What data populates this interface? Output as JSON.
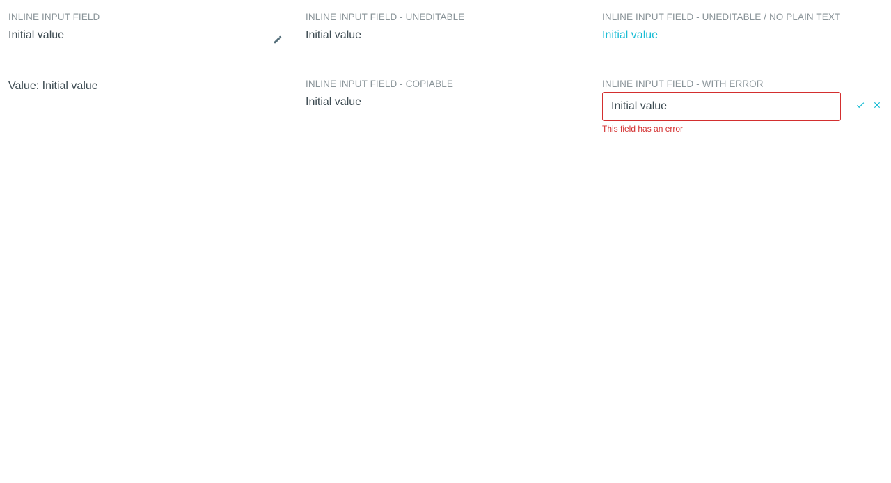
{
  "fields": {
    "inline": {
      "label": "INLINE INPUT FIELD",
      "value": "Initial value"
    },
    "uneditable": {
      "label": "INLINE INPUT FIELD - UNEDITABLE",
      "value": "Initial value"
    },
    "uneditable_no_plain": {
      "label": "INLINE INPUT FIELD - UNEDITABLE / NO PLAIN TEXT",
      "value": "Initial value"
    },
    "value_display": {
      "text": "Value: Initial value"
    },
    "copiable": {
      "label": "INLINE INPUT FIELD - COPIABLE",
      "value": "Initial value"
    },
    "with_error": {
      "label": "INLINE INPUT FIELD - WITH ERROR",
      "value": "Initial value",
      "error": "This field has an error"
    }
  },
  "icons": {
    "edit": "pencil-icon",
    "confirm": "check-icon",
    "cancel": "close-icon"
  },
  "colors": {
    "accent": "#19bcd4",
    "error": "#d32f2f",
    "label": "#8a9499",
    "text": "#3d4b52"
  }
}
